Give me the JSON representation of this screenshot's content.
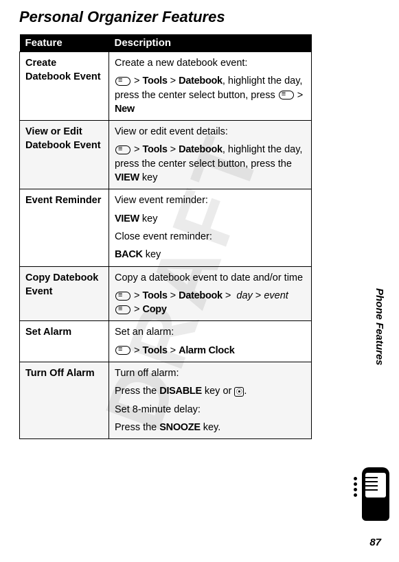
{
  "watermark": "DRAFT",
  "title": "Personal Organizer Features",
  "headers": {
    "feature": "Feature",
    "description": "Description"
  },
  "rows": [
    {
      "feature": "Create Datebook Event",
      "d1": "Create a new datebook event:",
      "path1a": "Tools",
      "path1b": "Datebook",
      "d2": ", highlight the day, press the center select button, press ",
      "end1": "New"
    },
    {
      "feature": "View or Edit Datebook Event",
      "d1": "View or edit event details:",
      "path1a": "Tools",
      "path1b": "Datebook",
      "d2": ", highlight the day, press the center select button, press the ",
      "key1": "VIEW",
      "tail": " key"
    },
    {
      "feature": "Event Reminder",
      "d1": "View event reminder:",
      "key1": "VIEW",
      "tail1": " key",
      "d2": "Close event reminder:",
      "key2": "BACK",
      "tail2": " key"
    },
    {
      "feature": "Copy Datebook Event",
      "d1": "Copy a datebook event to date and/or time",
      "path1a": "Tools",
      "path1b": "Datebook",
      "day": "day",
      "event": "event",
      "end1": "Copy"
    },
    {
      "feature": "Set Alarm",
      "d1": "Set an alarm:",
      "path1a": "Tools",
      "path1b": "Alarm Clock"
    },
    {
      "feature": "Turn Off Alarm",
      "d1": "Turn off alarm:",
      "d2a": "Press the ",
      "key1": "DISABLE",
      "d2b": " key or ",
      "d2c": ".",
      "d3": "Set 8-minute delay:",
      "d4a": "Press the ",
      "key2": "SNOOZE",
      "d4b": " key."
    }
  ],
  "side_label": "Phone Features",
  "page_number": "87"
}
